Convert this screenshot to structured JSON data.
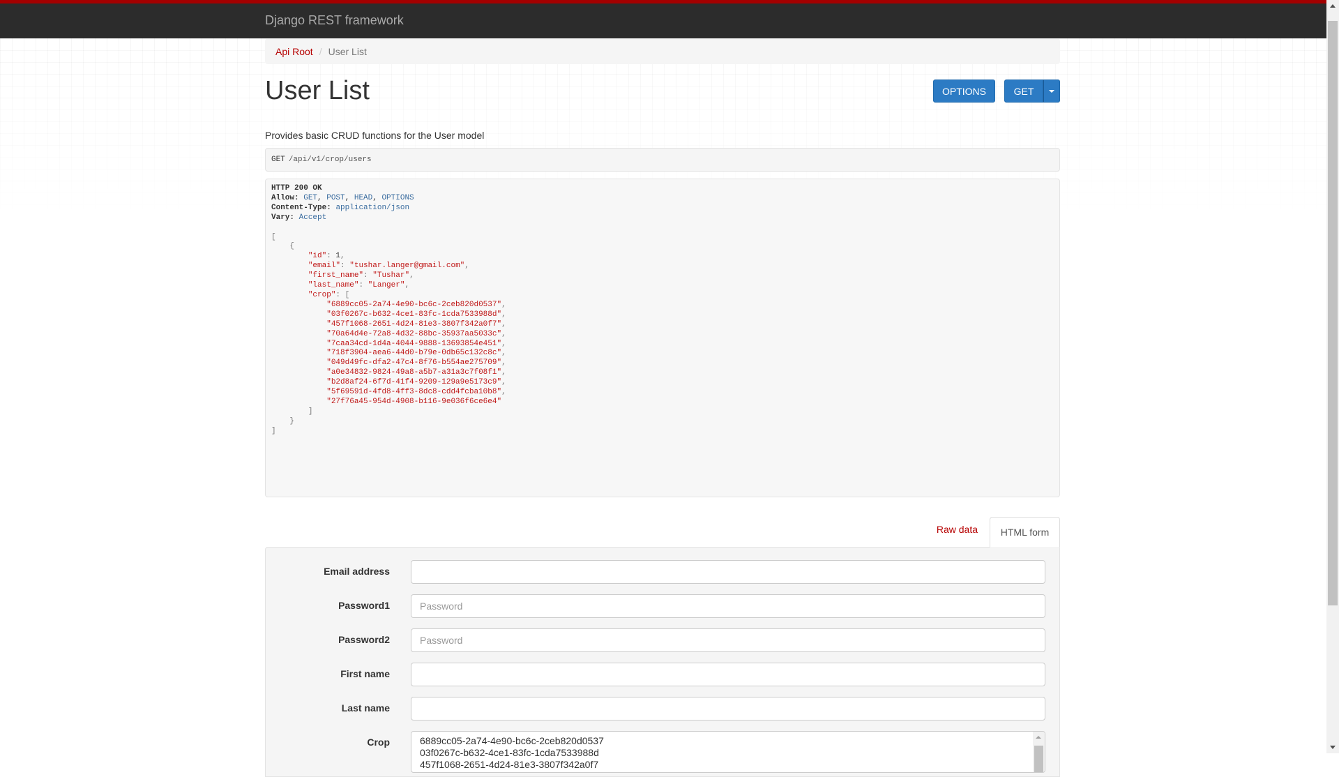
{
  "navbar": {
    "brand": "Django REST framework"
  },
  "breadcrumb": {
    "root": "Api Root",
    "separator": "/",
    "current": "User List"
  },
  "header": {
    "title": "User List",
    "options_label": "OPTIONS",
    "get_label": "GET"
  },
  "description": "Provides basic CRUD functions for the User model",
  "request": {
    "method": "GET",
    "path": "/api/v1/crop/users"
  },
  "response": {
    "status": "HTTP 200 OK",
    "allow_key": "Allow:",
    "allow_values": [
      "GET",
      "POST",
      "HEAD",
      "OPTIONS"
    ],
    "content_type_key": "Content-Type:",
    "content_type": "application/json",
    "vary_key": "Vary:",
    "vary": "Accept",
    "user": {
      "id": 1,
      "email": "tushar.langer@gmail.com",
      "first_name": "Tushar",
      "last_name": "Langer",
      "crop": [
        "6889cc05-2a74-4e90-bc6c-2ceb820d0537",
        "03f0267c-b632-4ce1-83fc-1cda7533988d",
        "457f1068-2651-4d24-81e3-3807f342a0f7",
        "70a64d4e-72a8-4d32-88bc-35937aa5033c",
        "7caa34cd-1d4a-4044-9888-13693854e451",
        "718f3904-aea6-44d0-b79e-0db65c132c8c",
        "049d49fc-dfa2-47c4-8f76-b554ae275709",
        "a0e34832-9824-49a8-a5b7-a31a3c7f08f1",
        "b2d8af24-6f7d-41f4-9209-129a9e5173c9",
        "5f69591d-4fd8-4ff3-8dc8-cdd4fcba10b8",
        "27f76a45-954d-4908-b116-9e036f6ce6e4"
      ]
    }
  },
  "tabs": {
    "raw": "Raw data",
    "html": "HTML form"
  },
  "form": {
    "email_label": "Email address",
    "email_value": "",
    "password1_label": "Password1",
    "password1_placeholder": "Password",
    "password2_label": "Password2",
    "password2_placeholder": "Password",
    "first_name_label": "First name",
    "first_name_value": "",
    "last_name_label": "Last name",
    "last_name_value": "",
    "crop_label": "Crop",
    "crop_options": [
      "6889cc05-2a74-4e90-bc6c-2ceb820d0537",
      "03f0267c-b632-4ce1-83fc-1cda7533988d",
      "457f1068-2651-4d24-81e3-3807f342a0f7"
    ]
  }
}
